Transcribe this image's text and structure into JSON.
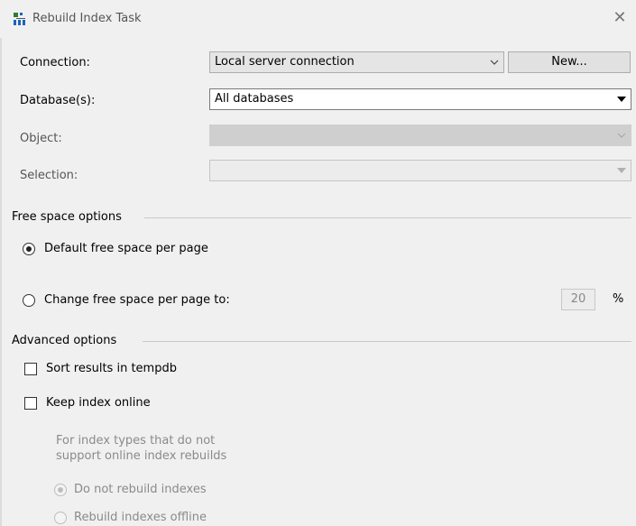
{
  "window": {
    "title": "Rebuild Index Task",
    "close_icon": "close-icon"
  },
  "form": {
    "connection": {
      "label": "Connection:",
      "value": "Local server connection",
      "new_button": "New..."
    },
    "databases": {
      "label": "Database(s):",
      "value": "All databases"
    },
    "object": {
      "label": "Object:",
      "value": ""
    },
    "selection": {
      "label": "Selection:",
      "value": ""
    }
  },
  "free_space": {
    "title": "Free space options",
    "default_label": "Default free space per page",
    "change_label": "Change free space per page to:",
    "percent_value": "20",
    "percent_unit": "%",
    "selected": "default"
  },
  "advanced": {
    "title": "Advanced options",
    "sort_tempdb": "Sort results in tempdb",
    "keep_online": "Keep index online",
    "note_line1": "For index types that do not",
    "note_line2": "support online index rebuilds",
    "do_not_rebuild": "Do not rebuild indexes",
    "rebuild_offline": "Rebuild indexes offline"
  },
  "colors": {
    "background": "#f0f0f0",
    "disabled_fill": "#cfcfcf"
  }
}
